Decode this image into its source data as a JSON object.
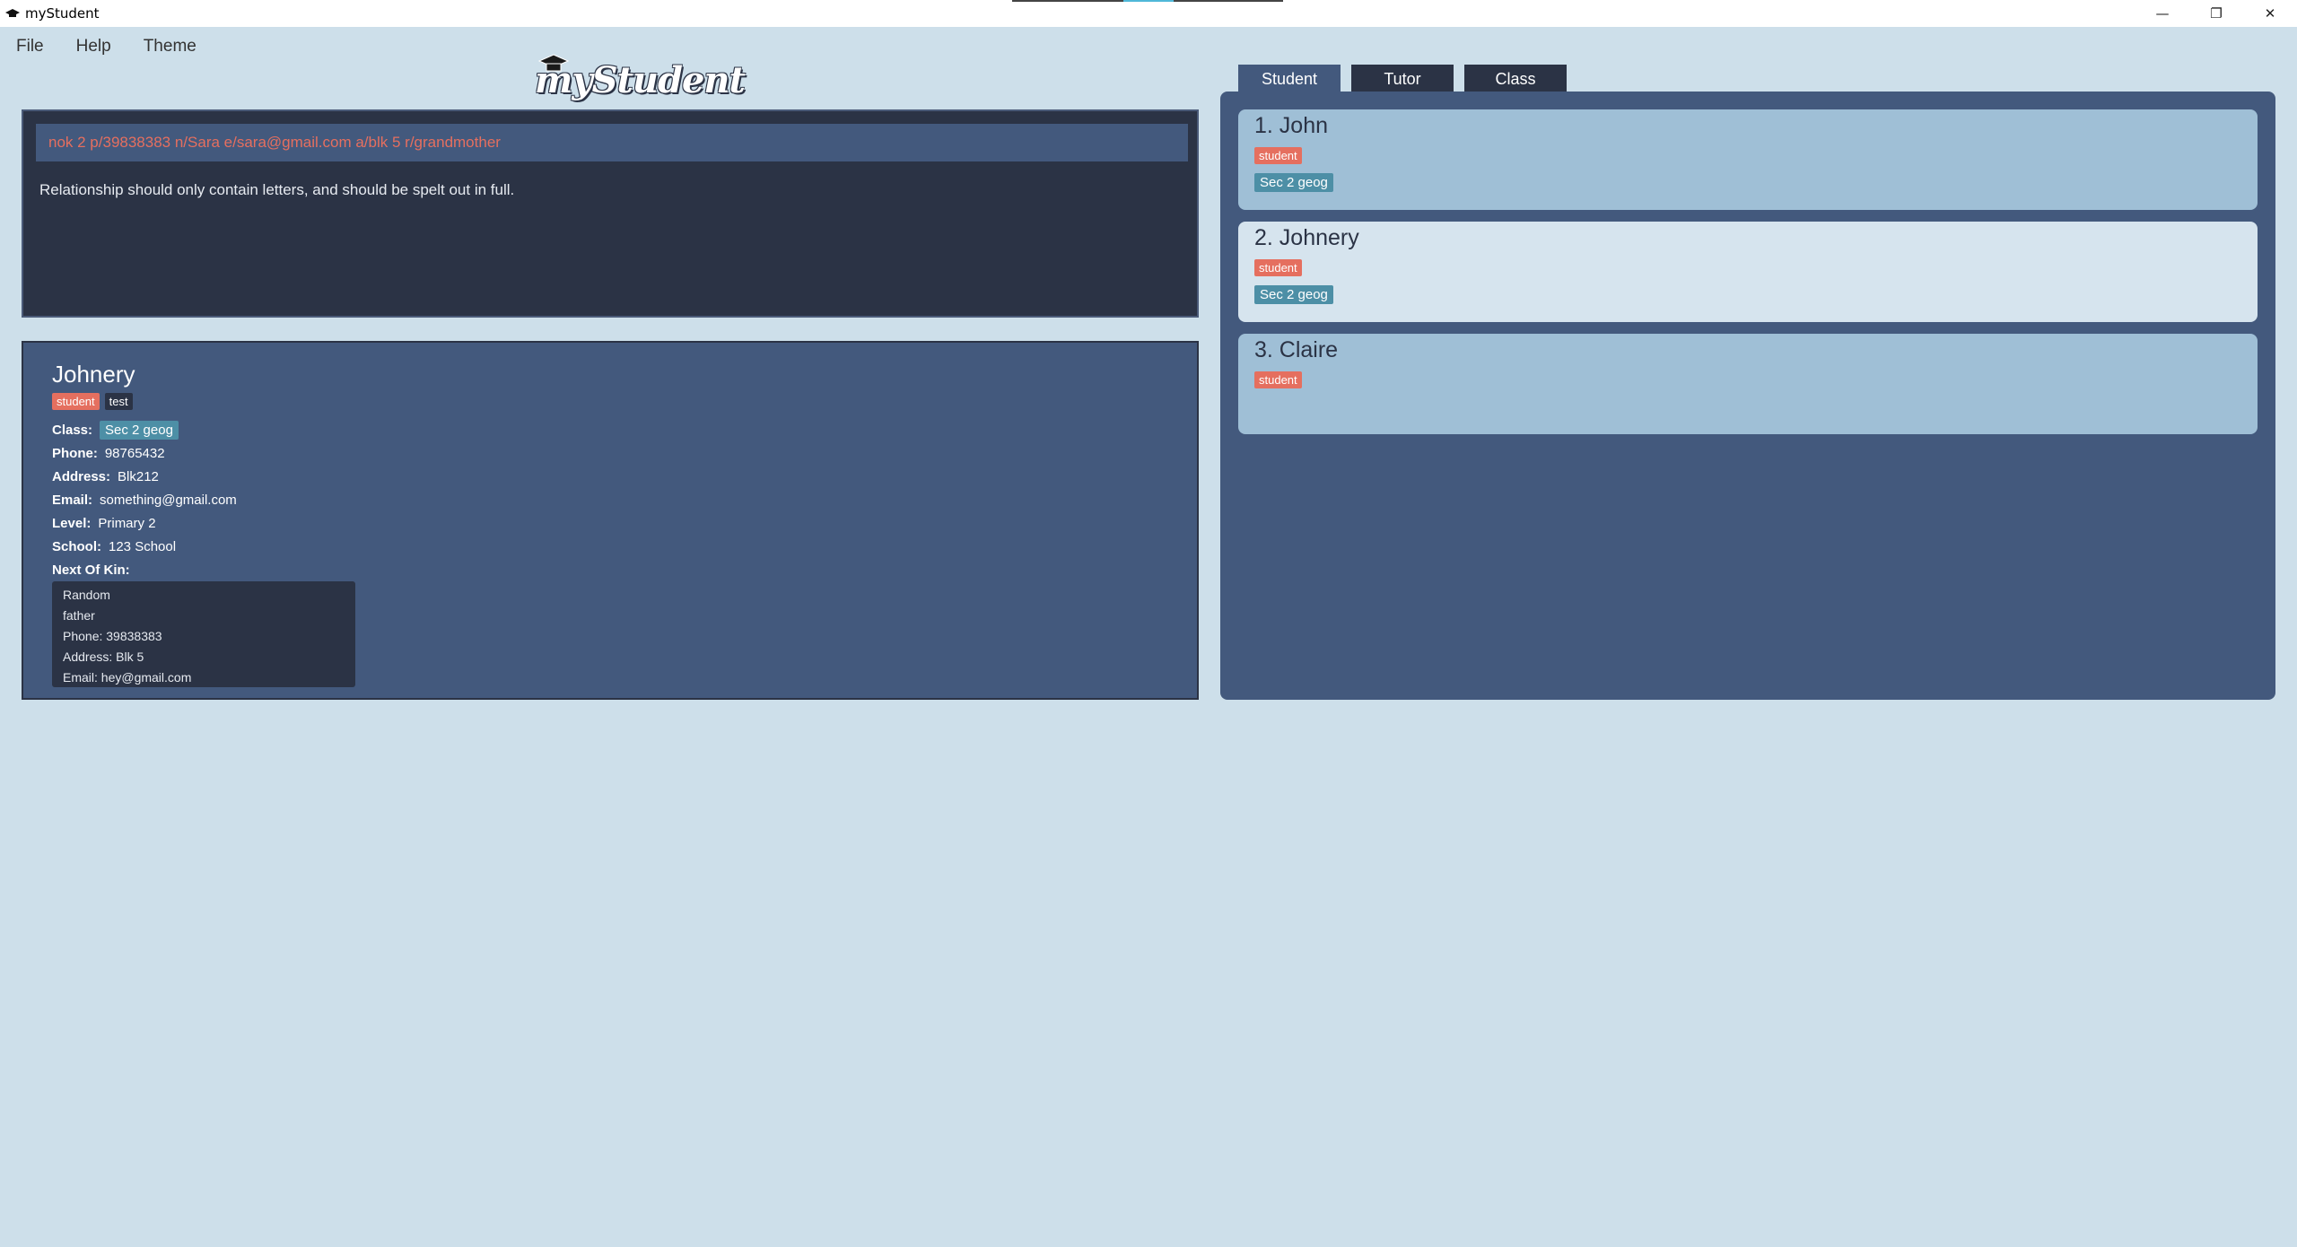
{
  "window": {
    "title": "myStudent",
    "controls": {
      "minimize": "—",
      "restore": "❐",
      "close": "✕"
    }
  },
  "menu": [
    "File",
    "Help",
    "Theme"
  ],
  "logo": {
    "text": "myStudent",
    "icon": "graduation-cap-icon"
  },
  "command": {
    "value": "nok 2 p/39838383 n/Sara e/sara@gmail.com a/blk 5 r/grandmother",
    "result": "Relationship should only contain letters, and should be spelt out in full."
  },
  "detail": {
    "name": "Johnery",
    "tags": [
      "student",
      "test"
    ],
    "class_label": "Class:",
    "class_value": "Sec 2 geog",
    "phone_label": "Phone:",
    "phone": "98765432",
    "address_label": "Address:",
    "address": "Blk212",
    "email_label": "Email:",
    "email": "something@gmail.com",
    "level_label": "Level:",
    "level": "Primary 2",
    "school_label": "School:",
    "school": "123 School",
    "nok_label": "Next Of Kin:",
    "nok": {
      "name": "Random",
      "relationship": "father",
      "phone": "Phone:  39838383",
      "address": "Address:  Blk 5",
      "email": "Email:  hey@gmail.com"
    }
  },
  "tabs": [
    "Student",
    "Tutor",
    "Class"
  ],
  "active_tab": "Student",
  "students": [
    {
      "title": "1. John",
      "tag": "student",
      "class": "Sec 2 geog"
    },
    {
      "title": "2. Johnery",
      "tag": "student",
      "class": "Sec 2 geog"
    },
    {
      "title": "3. Claire",
      "tag": "student"
    }
  ],
  "colors": {
    "background": "#cddfea",
    "panel_dark": "#2b3345",
    "panel_blue": "#43597d",
    "tag_student": "#e56f5f",
    "tag_class": "#4d8fa6",
    "card_selected": "#d6e4ee",
    "card_default": "#9fbfd6"
  }
}
